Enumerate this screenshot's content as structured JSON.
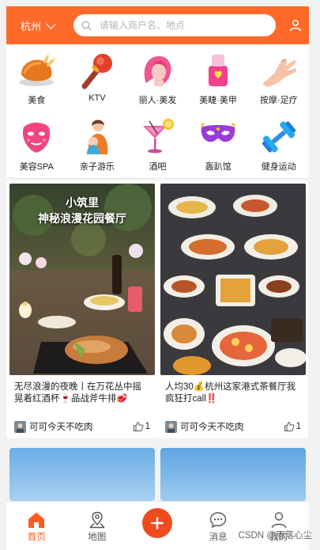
{
  "header": {
    "city": "杭州",
    "search_placeholder": "请输入商户名、地点"
  },
  "categories": [
    {
      "label": "美食",
      "icon": "roast-chicken-icon"
    },
    {
      "label": "KTV",
      "icon": "microphone-icon"
    },
    {
      "label": "丽人·美发",
      "icon": "hair-salon-icon"
    },
    {
      "label": "美睫·美甲",
      "icon": "nail-polish-icon"
    },
    {
      "label": "按摩·足疗",
      "icon": "massage-hand-icon"
    },
    {
      "label": "美容SPA",
      "icon": "face-mask-icon"
    },
    {
      "label": "亲子游乐",
      "icon": "parent-child-icon"
    },
    {
      "label": "酒吧",
      "icon": "cocktail-icon"
    },
    {
      "label": "轰趴馆",
      "icon": "party-mask-icon"
    },
    {
      "label": "健身运动",
      "icon": "dumbbell-icon"
    }
  ],
  "feed": [
    {
      "overlay_line1": "小筑里",
      "overlay_line2": "神秘浪漫花园餐厅",
      "title": "无尽浪漫的夜晚丨在万花丛中摇晃着红酒杯🍷品战斧牛排🥩",
      "author": "可可今天不吃肉",
      "likes": "1"
    },
    {
      "title": "人均30💰杭州这家港式茶餐厅我疯狂打call‼️",
      "author": "可可今天不吃肉",
      "likes": "1"
    }
  ],
  "tabbar": {
    "items": [
      {
        "label": "首页",
        "icon": "home-icon",
        "active": true
      },
      {
        "label": "地图",
        "icon": "map-pin-icon",
        "active": false
      },
      {
        "label": "",
        "icon": "plus-icon",
        "active": false
      },
      {
        "label": "消息",
        "icon": "message-icon",
        "active": false
      },
      {
        "label": "我的",
        "icon": "profile-icon",
        "active": false
      }
    ]
  },
  "watermark": "CSDN @雨落心尘",
  "colors": {
    "brand": "#ff6a2a",
    "active_tab": "#ff5a1f",
    "plus_button": "#f04a1f"
  }
}
